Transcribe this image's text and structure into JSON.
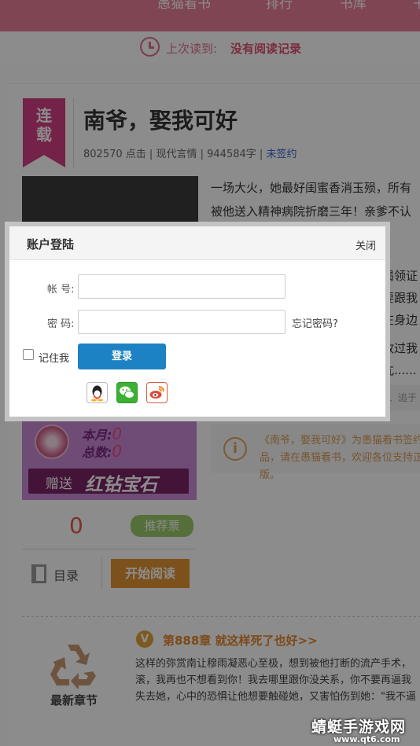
{
  "header": {
    "nav": [
      "愚猫看书",
      "排行",
      "书库",
      "书"
    ]
  },
  "last_read": {
    "label": "上次读到:",
    "value": "没有阅读记录"
  },
  "book": {
    "ribbon_top": "连",
    "ribbon_bottom": "载",
    "title": "南爷，娶我可好",
    "clicks": "802570 点击",
    "sep1": "|",
    "genre": "现代言情",
    "sep2": "|",
    "words": "944584字",
    "sep3": "|",
    "status": "未签约",
    "intro_lines": [
      "一场大火，她最好闺蜜香消玉殒，所有",
      "被他送入精神病院折磨三年！亲爹不认"
    ],
    "intro_right_fragments": [
      "偈领证",
      "要跟我",
      "在身边",
      "放过我",
      "亢......"
    ],
    "tags_fragment": "票、追于"
  },
  "gift": {
    "month_label": "本月:",
    "month_value": "0",
    "total_label": "总数:",
    "total_value": "0",
    "send_label": "赠送",
    "gift_name": "红钻宝石"
  },
  "notice": {
    "text": "《南爷，娶我可好》为愚猫看书签约作品，请在愚猫看书，欢迎各位支持正版。"
  },
  "votes": {
    "count": "0",
    "button": "推荐票"
  },
  "actions": {
    "toc": "目录",
    "start": "开始阅读"
  },
  "latest": {
    "label": "最新章节",
    "badge": "V",
    "chapter": "第888章 就这样死了也好>>",
    "lines": [
      "这样的弥赏南让穆雨凝恶心至极，想到被他打断的流产手术，",
      "滚，我再也不想看到你！我去哪里跟你没关系，你不要再逼我",
      "失去她，心中的恐惧让他想要触碰她，又害怕伤到她：\"我不逼"
    ]
  },
  "modal": {
    "title": "账户登陆",
    "close": "关闭",
    "account_label": "帐 号:",
    "account_value": "",
    "password_label": "密 码:",
    "password_value": "",
    "forgot": "忘记密码?",
    "remember": "记住我",
    "login": "登录",
    "social": [
      "qq-icon",
      "wechat-icon",
      "weibo-icon"
    ]
  },
  "watermark": {
    "main": "蜻蜓手游戏网",
    "sub": "www.qt6.com"
  },
  "colors": {
    "brand_pink": "#e97f97",
    "ribbon": "#d43f83",
    "login_blue": "#1d82c3",
    "start_orange": "#e39432",
    "vote_green": "#9ccb6a"
  }
}
